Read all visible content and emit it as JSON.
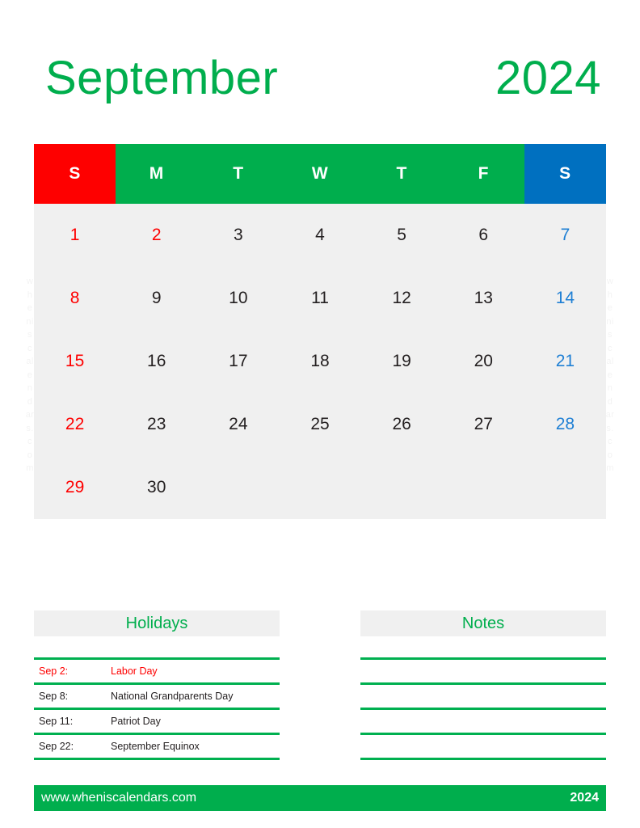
{
  "title": {
    "month": "September",
    "year": "2024",
    "color": "#00AE4D"
  },
  "colors": {
    "green": "#00AE4D",
    "line_green": "#00B050",
    "red": "#FE0000",
    "blue": "#0070C0",
    "saturday_number": "#1E7FD4",
    "cell_background": "#F0F0F0",
    "text": "#231F20",
    "watermark": "#F3F3F3"
  },
  "watermark": {
    "text": "wheniscalendars.com",
    "lines": [
      "w",
      "h",
      "e",
      "ni",
      "s",
      "c",
      "al",
      "e",
      "n",
      "d",
      "ar",
      "s.",
      "c",
      "o",
      "m"
    ]
  },
  "calendar": {
    "weekday_headers": [
      {
        "label": "S",
        "kind": "sun"
      },
      {
        "label": "M",
        "kind": "wk"
      },
      {
        "label": "T",
        "kind": "wk"
      },
      {
        "label": "W",
        "kind": "wk"
      },
      {
        "label": "T",
        "kind": "wk"
      },
      {
        "label": "F",
        "kind": "wk"
      },
      {
        "label": "S",
        "kind": "sat"
      }
    ],
    "weeks": [
      [
        {
          "day": "1",
          "kind": "sun"
        },
        {
          "day": "2",
          "kind": "holiday"
        },
        {
          "day": "3",
          "kind": "wk"
        },
        {
          "day": "4",
          "kind": "wk"
        },
        {
          "day": "5",
          "kind": "wk"
        },
        {
          "day": "6",
          "kind": "wk"
        },
        {
          "day": "7",
          "kind": "sat"
        }
      ],
      [
        {
          "day": "8",
          "kind": "sun"
        },
        {
          "day": "9",
          "kind": "wk"
        },
        {
          "day": "10",
          "kind": "wk"
        },
        {
          "day": "11",
          "kind": "wk"
        },
        {
          "day": "12",
          "kind": "wk"
        },
        {
          "day": "13",
          "kind": "wk"
        },
        {
          "day": "14",
          "kind": "sat"
        }
      ],
      [
        {
          "day": "15",
          "kind": "sun"
        },
        {
          "day": "16",
          "kind": "wk"
        },
        {
          "day": "17",
          "kind": "wk"
        },
        {
          "day": "18",
          "kind": "wk"
        },
        {
          "day": "19",
          "kind": "wk"
        },
        {
          "day": "20",
          "kind": "wk"
        },
        {
          "day": "21",
          "kind": "sat"
        }
      ],
      [
        {
          "day": "22",
          "kind": "sun"
        },
        {
          "day": "23",
          "kind": "wk"
        },
        {
          "day": "24",
          "kind": "wk"
        },
        {
          "day": "25",
          "kind": "wk"
        },
        {
          "day": "26",
          "kind": "wk"
        },
        {
          "day": "27",
          "kind": "wk"
        },
        {
          "day": "28",
          "kind": "sat"
        }
      ],
      [
        {
          "day": "29",
          "kind": "sun"
        },
        {
          "day": "30",
          "kind": "wk"
        },
        {
          "day": "",
          "kind": "empty"
        },
        {
          "day": "",
          "kind": "empty"
        },
        {
          "day": "",
          "kind": "empty"
        },
        {
          "day": "",
          "kind": "empty"
        },
        {
          "day": "",
          "kind": "empty"
        }
      ]
    ]
  },
  "holidays": {
    "heading": "Holidays",
    "rows": [
      {
        "date": "Sep 2:",
        "label": "Labor Day",
        "highlight": true
      },
      {
        "date": "Sep 8:",
        "label": "National Grandparents Day",
        "highlight": false
      },
      {
        "date": "Sep 11:",
        "label": "Patriot Day",
        "highlight": false
      },
      {
        "date": "Sep 22:",
        "label": "September Equinox",
        "highlight": false
      }
    ]
  },
  "notes": {
    "heading": "Notes",
    "rows": [
      "",
      "",
      "",
      ""
    ]
  },
  "footer": {
    "site": "www.wheniscalendars.com",
    "year": "2024"
  }
}
